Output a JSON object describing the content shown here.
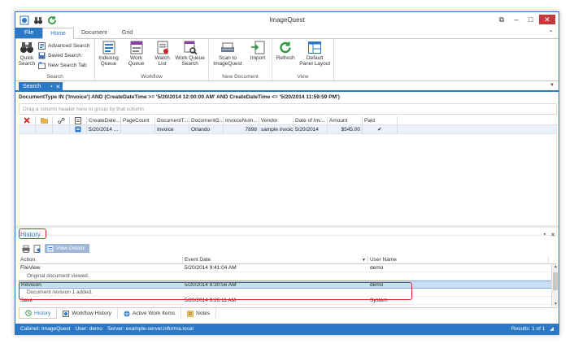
{
  "window": {
    "title": "ImageQuest"
  },
  "ribbon_tabs": [
    "File",
    "Home",
    "Document",
    "Grid"
  ],
  "ribbon": {
    "search": {
      "label": "Search",
      "quick_search": "Quick\nSearch",
      "advanced_search": "Advanced Search",
      "saved_search": "Saved Search",
      "new_search_tab": "New Search Tab"
    },
    "workflow": {
      "label": "Workflow",
      "indexing_queue": "Indexing\nQueue",
      "work_queue": "Work Queue",
      "watch_list": "Watch\nList",
      "work_queue_search": "Work Queue\nSearch"
    },
    "new_document": {
      "label": "New Document",
      "scan": "Scan to\nImageQuest",
      "import": "Import"
    },
    "view": {
      "label": "View",
      "refresh": "Refresh",
      "default_panel_layout": "Default\nPanel Layout"
    }
  },
  "doc_tab": {
    "label": "Search"
  },
  "query": "DocumentType IN ('Invoice') AND (CreateDateTime >= '5/20/2014 12:00:00 AM' AND CreateDateTime <= '5/20/2014 11:59:59 PM')",
  "groupby_hint": "Drag a column header here to group by that column",
  "grid": {
    "columns": [
      "CreateDate...",
      "PageCount",
      "DocumentT...",
      "DocumentG...",
      "InvoiceNum...",
      "Vendor",
      "Date of Inv...",
      "Amount",
      "Paid"
    ],
    "rows": [
      [
        "5/20/2014 ...",
        "",
        "Invoice",
        "Orlando",
        "7898",
        "sample invoice",
        "5/20/2014",
        "$545.00",
        "✔"
      ]
    ]
  },
  "history": {
    "title": "History",
    "view_details": "View Details",
    "columns": [
      "Action",
      "Event Date",
      "User Name"
    ],
    "rows": [
      {
        "action": "FileView",
        "date": "5/20/2014 9:41:04 AM",
        "user": "demo",
        "sub": "Original document viewed."
      },
      {
        "action": "Revision",
        "date": "5/20/2014 9:30:56 AM",
        "user": "demo",
        "sub": "Document revision 1 added."
      },
      {
        "action": "Save",
        "date": "5/20/2014 9:26:11 AM",
        "user": "System",
        "sub": ""
      }
    ]
  },
  "bottom_tabs": [
    "History",
    "Workflow History",
    "Active Work Items",
    "Notes"
  ],
  "status": {
    "cabinet": "Cabinet: ImageQuest",
    "user": "User: demo",
    "server": "Server: example-server.informa.local",
    "results": "Results: 1 of 1"
  },
  "colors": {
    "accent": "#2b79c6",
    "annotation": "#d0262a",
    "selected_row": "#c9ddf4"
  }
}
